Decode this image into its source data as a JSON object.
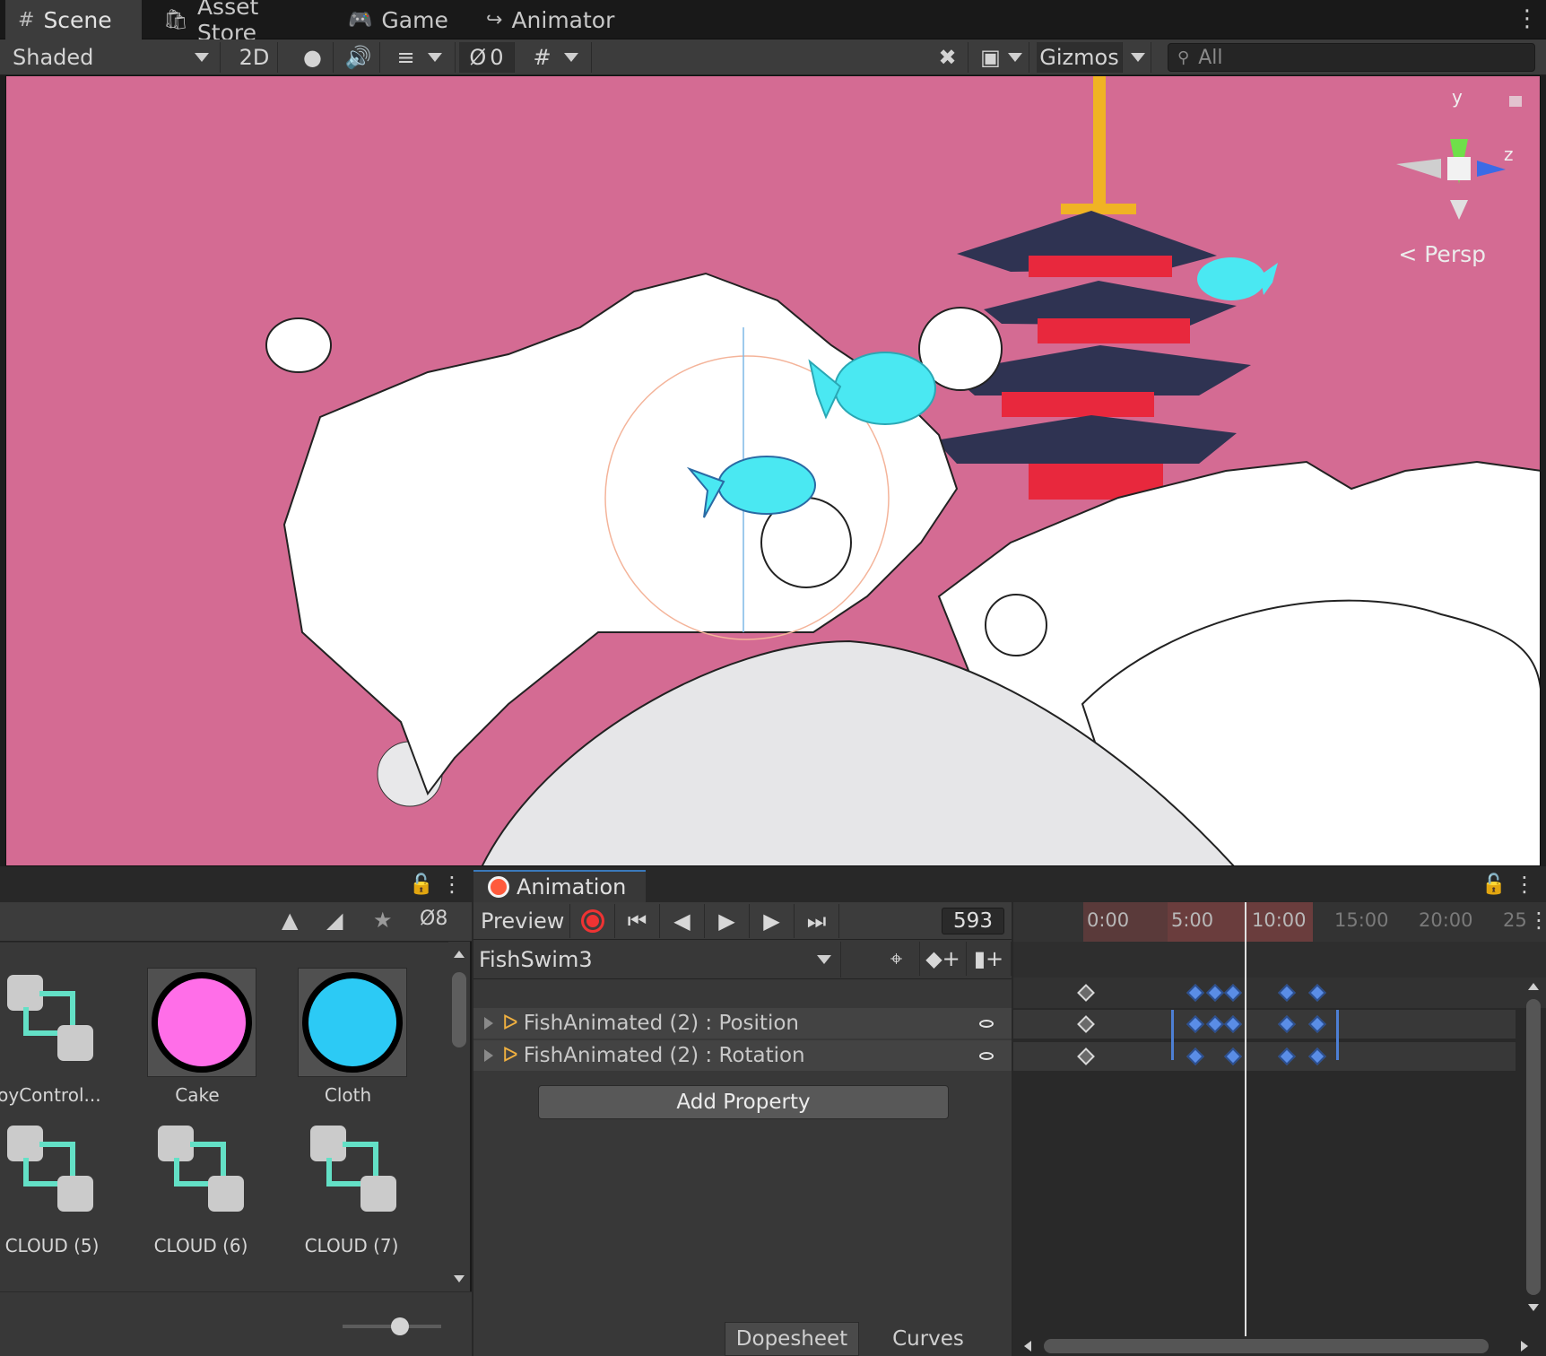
{
  "tabs": [
    {
      "label": "Scene",
      "icon": "grid-icon"
    },
    {
      "label": "Asset Store",
      "icon": "shopping-bag-icon"
    },
    {
      "label": "Game",
      "icon": "gamepad-icon"
    },
    {
      "label": "Animator",
      "icon": "animator-icon"
    }
  ],
  "scene_toolbar": {
    "shading_mode": "Shaded",
    "mode_2d": "2D",
    "hidden_count": "0",
    "gizmos": "Gizmos",
    "search_placeholder": "All"
  },
  "viewport": {
    "background": "#d46b93",
    "projection": "Persp",
    "axes": {
      "y": "y",
      "z": "z"
    }
  },
  "project": {
    "hidden_count": "8",
    "assets": [
      {
        "name": "BoyControl...",
        "type": "animator-controller"
      },
      {
        "name": "Cake",
        "type": "material",
        "color": "#ff6ee8"
      },
      {
        "name": "Cloth",
        "type": "material",
        "color": "#2ccaf5"
      },
      {
        "name": "CLOUD (5)",
        "type": "animator-controller"
      },
      {
        "name": "CLOUD (6)",
        "type": "animator-controller"
      },
      {
        "name": "CLOUD (7)",
        "type": "animator-controller"
      }
    ]
  },
  "animation": {
    "tab_title": "Animation",
    "preview": "Preview",
    "frame": "593",
    "clip": "FishSwim3",
    "properties": [
      "FishAnimated (2) : Position",
      "FishAnimated (2) : Rotation"
    ],
    "add_property": "Add Property",
    "dopesheet": "Dopesheet",
    "curves": "Curves",
    "ruler_labels": [
      "0:00",
      "5:00",
      "10:00",
      "15:00",
      "20:00",
      "25"
    ]
  }
}
